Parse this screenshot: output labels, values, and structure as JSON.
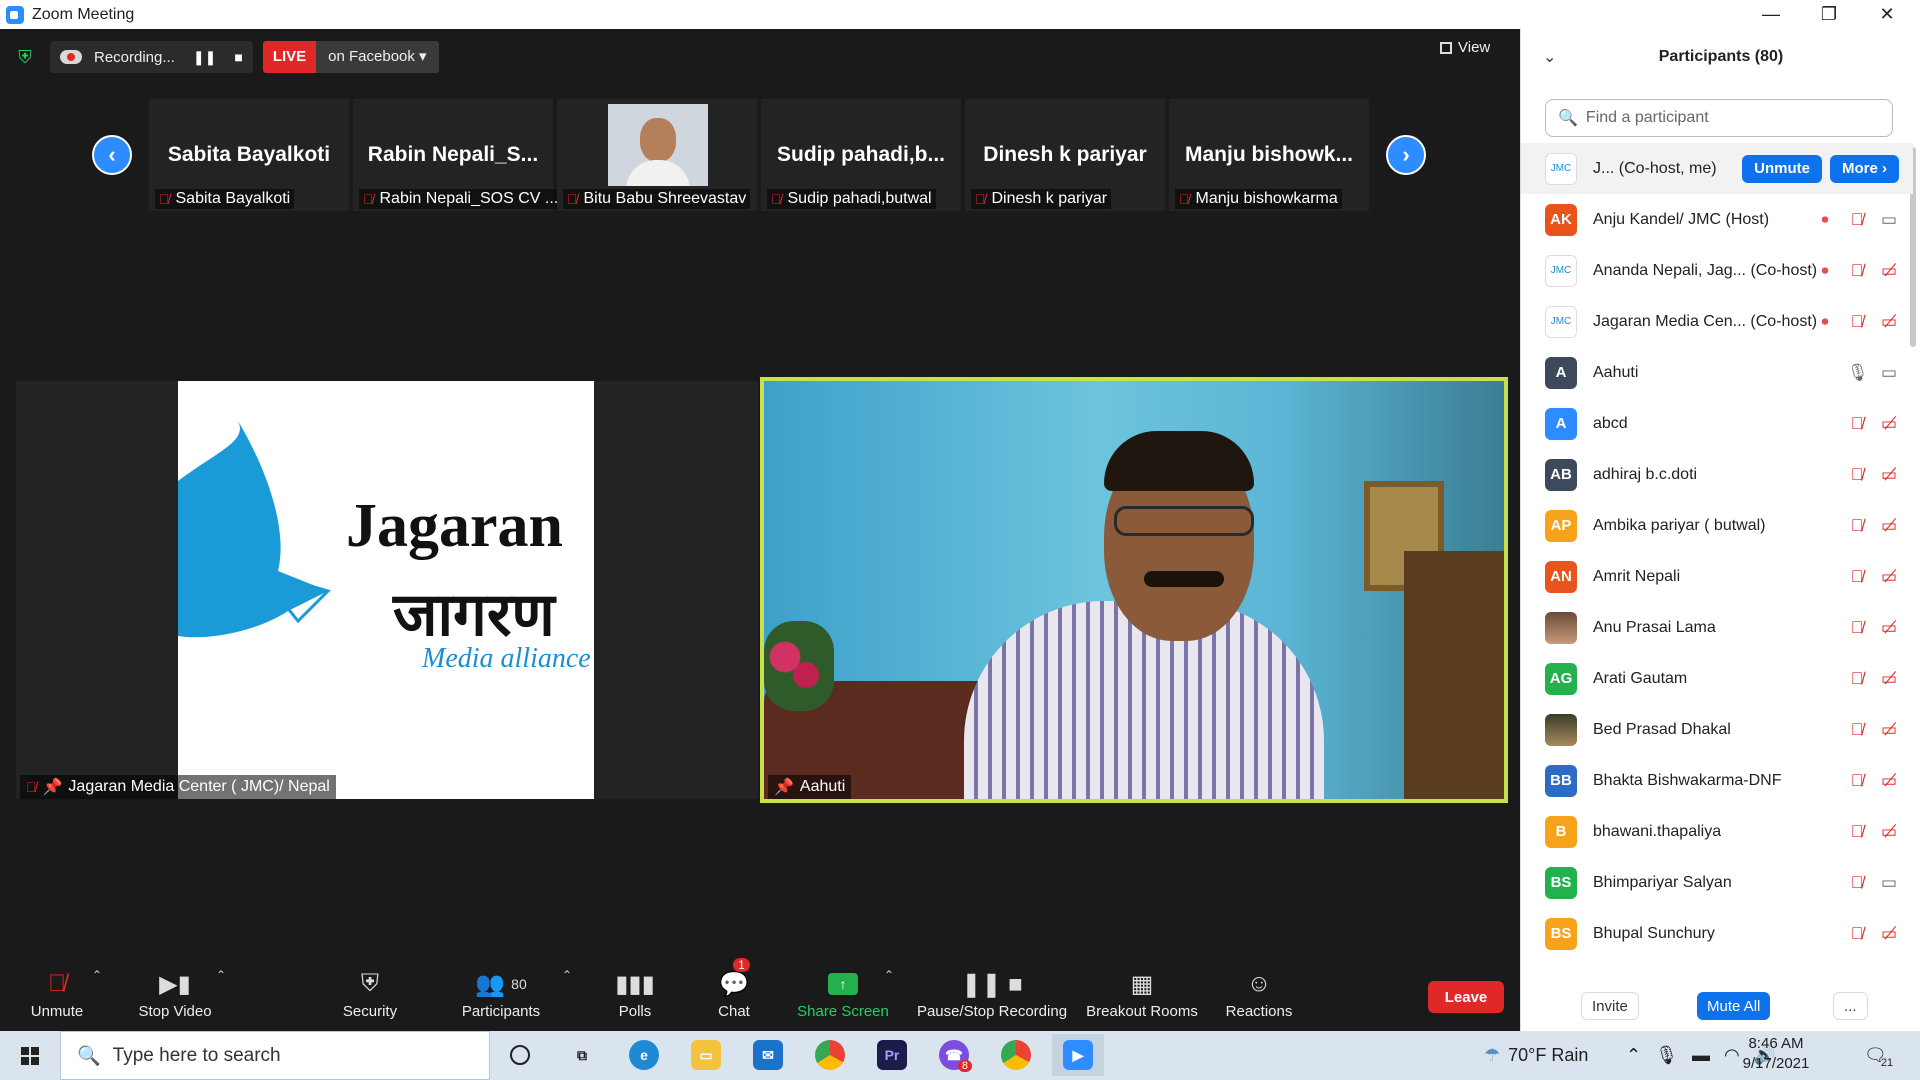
{
  "window": {
    "title": "Zoom Meeting",
    "minimize": "—",
    "restore": "❐",
    "close": "✕"
  },
  "recording": {
    "label": "Recording...",
    "pause": "❚❚",
    "stop": "■"
  },
  "live": {
    "tag": "LIVE",
    "destination": "on Facebook ▾"
  },
  "view": {
    "label": "View"
  },
  "strip": {
    "prev": "‹",
    "next": "›",
    "tiles": [
      {
        "big": "Sabita Bayalkoti",
        "small": "Sabita Bayalkoti"
      },
      {
        "big": "Rabin  Nepali_S...",
        "small": "Rabin Nepali_SOS CV ..."
      },
      {
        "big": "",
        "small": "Bitu Babu Shreevastav"
      },
      {
        "big": "Sudip  pahadi,b...",
        "small": "Sudip pahadi,butwal"
      },
      {
        "big": "Dinesh  k pariyar",
        "small": "Dinesh  k pariyar"
      },
      {
        "big": "Manju  bishowk...",
        "small": "Manju bishowkarma"
      }
    ]
  },
  "main": {
    "left_name": "Jagaran Media Center ( JMC)/ Nepal",
    "slide": {
      "line1": "Jagaran",
      "line2": "जागरण",
      "line3": "Media alliance"
    },
    "right_name": "Aahuti"
  },
  "toolbar": {
    "unmute": "Unmute",
    "stop_video": "Stop Video",
    "security": "Security",
    "participants": "Participants",
    "participants_count": "80",
    "polls": "Polls",
    "chat": "Chat",
    "chat_badge": "1",
    "share": "Share Screen",
    "recording": "Pause/Stop Recording",
    "breakout": "Breakout Rooms",
    "reactions": "Reactions",
    "leave": "Leave"
  },
  "panel": {
    "title": "Participants (80)",
    "search_placeholder": "Find a participant",
    "me": {
      "name": "J...  (Co-host, me)",
      "unmute": "Unmute",
      "more": "More ›"
    },
    "participants": [
      {
        "initials": "AK",
        "name": "Anju Kandel/ JMC (Host)",
        "color": "#e8541c",
        "rec": true,
        "mic": "off",
        "cam": "on"
      },
      {
        "initials": "logo",
        "name": "Ananda Nepali, Jag...  (Co-host)",
        "color": "#ffffff",
        "rec": true,
        "mic": "off",
        "cam": "off"
      },
      {
        "initials": "logo",
        "name": "Jagaran Media Cen...  (Co-host)",
        "color": "#ffffff",
        "rec": true,
        "mic": "off",
        "cam": "off"
      },
      {
        "initials": "A",
        "name": "Aahuti",
        "color": "#3d4a5c",
        "rec": false,
        "mic": "on",
        "cam": "on"
      },
      {
        "initials": "A",
        "name": "abcd",
        "color": "#2d8cff",
        "rec": false,
        "mic": "off",
        "cam": "off"
      },
      {
        "initials": "AB",
        "name": "adhiraj b.c.doti",
        "color": "#3d4a5c",
        "rec": false,
        "mic": "off",
        "cam": "off"
      },
      {
        "initials": "AP",
        "name": "Ambika pariyar ( butwal)",
        "color": "#f7a21b",
        "rec": false,
        "mic": "off",
        "cam": "off"
      },
      {
        "initials": "AN",
        "name": "Amrit Nepali",
        "color": "#e8541c",
        "rec": false,
        "mic": "off",
        "cam": "off"
      },
      {
        "initials": "photo",
        "name": "Anu Prasai Lama",
        "color": "#8a5a4a",
        "rec": false,
        "mic": "off",
        "cam": "off"
      },
      {
        "initials": "AG",
        "name": "Arati Gautam",
        "color": "#23b14d",
        "rec": false,
        "mic": "off",
        "cam": "off"
      },
      {
        "initials": "photo",
        "name": "Bed Prasad Dhakal",
        "color": "#6a5a3a",
        "rec": false,
        "mic": "off",
        "cam": "off"
      },
      {
        "initials": "BB",
        "name": "Bhakta Bishwakarma-DNF",
        "color": "#2d6cc4",
        "rec": false,
        "mic": "off",
        "cam": "off"
      },
      {
        "initials": "B",
        "name": "bhawani.thapaliya",
        "color": "#f7a21b",
        "rec": false,
        "mic": "off",
        "cam": "off"
      },
      {
        "initials": "BS",
        "name": "Bhimpariyar Salyan",
        "color": "#23b14d",
        "rec": false,
        "mic": "off",
        "cam": "on"
      },
      {
        "initials": "BS",
        "name": "Bhupal Sunchury",
        "color": "#f7a21b",
        "rec": false,
        "mic": "off",
        "cam": "off"
      }
    ],
    "invite": "Invite",
    "mute_all": "Mute All",
    "more_dots": "..."
  },
  "taskbar": {
    "search_placeholder": "Type here to search",
    "weather": "70°F  Rain",
    "time": "8:46 AM",
    "date": "9/17/2021",
    "notif_count": "21",
    "viber_badge": "8"
  }
}
